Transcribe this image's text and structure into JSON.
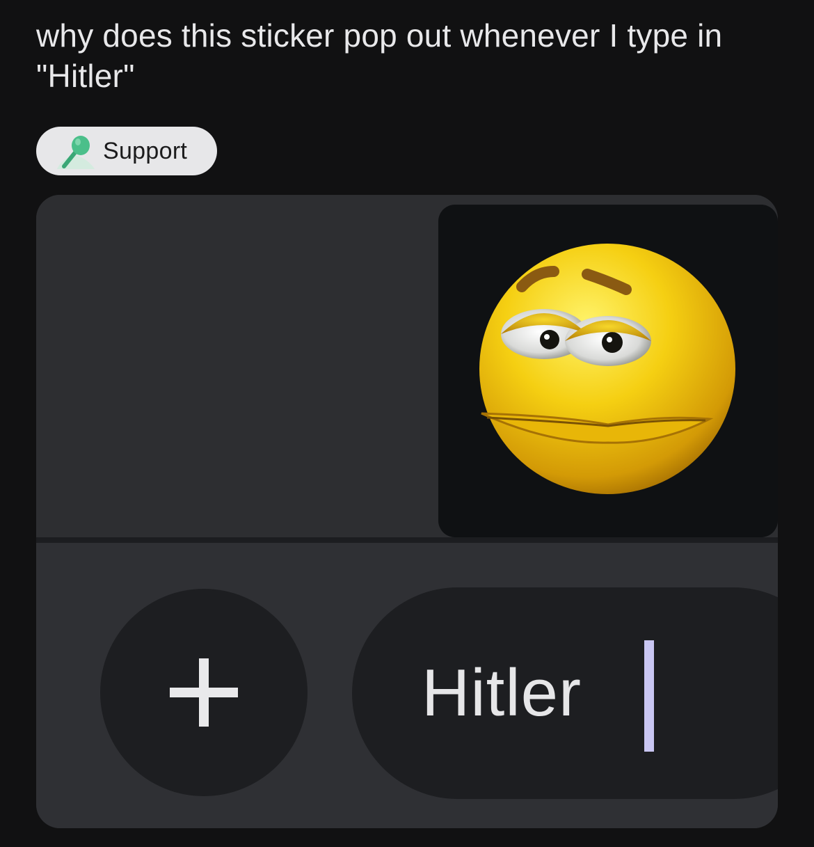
{
  "post": {
    "title": "why does this sticker pop out whenever I type in \"Hitler\"",
    "flair": {
      "label": "Support",
      "icon": "lightbulb-person-icon",
      "background": "#e7e7e9",
      "icon_color": "#4bbf8a"
    }
  },
  "chat_screenshot": {
    "sticker": {
      "icon": "sad-emoji-face-icon",
      "face_color": "#f2c40c"
    },
    "composer": {
      "add_icon": "plus-icon",
      "message_value": "Hitler",
      "caret_color": "#c9c6f2"
    }
  }
}
